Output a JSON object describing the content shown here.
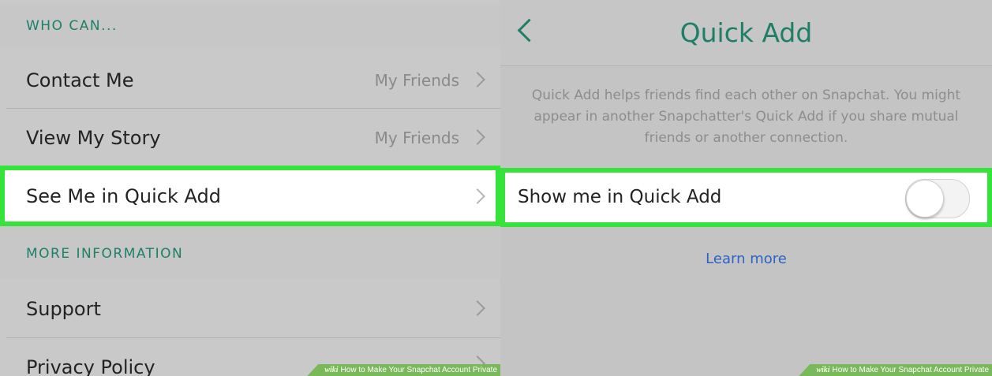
{
  "left": {
    "sections": [
      {
        "header": "WHO CAN..."
      },
      {
        "header": "MORE INFORMATION"
      }
    ],
    "rows": [
      {
        "label": "Contact Me",
        "value": "My Friends"
      },
      {
        "label": "View My Story",
        "value": "My Friends"
      },
      {
        "label": "See Me in Quick Add",
        "value": ""
      },
      {
        "label": "Support",
        "value": ""
      },
      {
        "label": "Privacy Policy",
        "value": ""
      }
    ]
  },
  "right": {
    "nav": {
      "title": "Quick Add",
      "back_icon": "chevron-left-icon"
    },
    "description": "Quick Add helps friends find each other on Snapchat. You might appear in another Snapchatter's Quick Add if you share mutual friends or another connection.",
    "toggle": {
      "label": "Show me in Quick Add",
      "state": "off"
    },
    "learn_more": "Learn more"
  },
  "watermark": {
    "logo": "wiki",
    "text": "How to Make Your Snapchat Account Private"
  },
  "colors": {
    "accent": "#1f7f66",
    "highlight": "#35e33b",
    "link": "#2c63c4"
  }
}
